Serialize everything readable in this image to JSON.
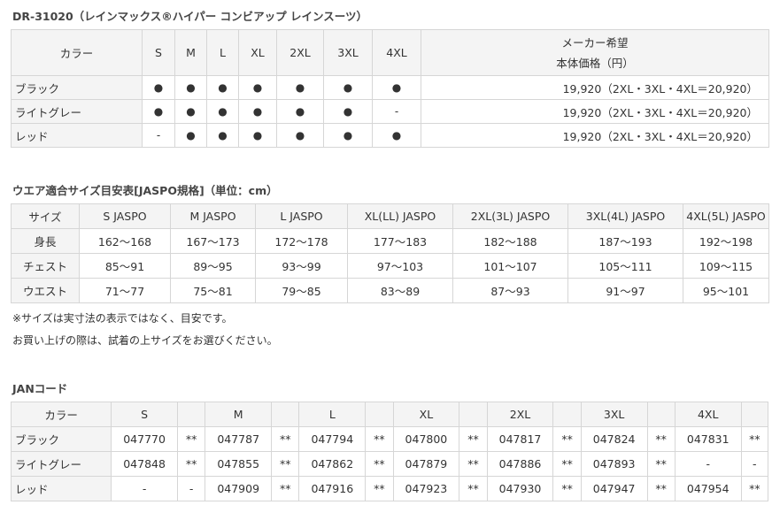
{
  "product": {
    "title": "DR-31020（レインマックス®ハイパー コンビアップ レインスーツ）",
    "price_table": {
      "color_header": "カラー",
      "sizes": [
        "S",
        "M",
        "L",
        "XL",
        "2XL",
        "3XL",
        "4XL"
      ],
      "price_header_line1": "メーカー希望",
      "price_header_line2": "本体価格（円）",
      "rows": [
        {
          "color": "ブラック",
          "avail": [
            "●",
            "●",
            "●",
            "●",
            "●",
            "●",
            "●"
          ],
          "price": "19,920（2XL・3XL・4XL＝20,920）"
        },
        {
          "color": "ライトグレー",
          "avail": [
            "●",
            "●",
            "●",
            "●",
            "●",
            "●",
            "-"
          ],
          "price": "19,920（2XL・3XL・4XL＝20,920）"
        },
        {
          "color": "レッド",
          "avail": [
            "-",
            "●",
            "●",
            "●",
            "●",
            "●",
            "●"
          ],
          "price": "19,920（2XL・3XL・4XL＝20,920）"
        }
      ]
    }
  },
  "size_guide": {
    "title": "ウエア適合サイズ目安表[JASPO規格]（単位：cm）",
    "header_label": "サイズ",
    "columns": [
      "S JASPO",
      "M JASPO",
      "L JASPO",
      "XL(LL) JASPO",
      "2XL(3L) JASPO",
      "3XL(4L) JASPO",
      "4XL(5L) JASPO"
    ],
    "rows": [
      {
        "label": "身長",
        "values": [
          "162～168",
          "167～173",
          "172～178",
          "177～183",
          "182～188",
          "187～193",
          "192～198"
        ]
      },
      {
        "label": "チェスト",
        "values": [
          "85～91",
          "89～95",
          "93～99",
          "97～103",
          "101～107",
          "105～111",
          "109～115"
        ]
      },
      {
        "label": "ウエスト",
        "values": [
          "71～77",
          "75～81",
          "79～85",
          "83～89",
          "87～93",
          "91～97",
          "95～101"
        ]
      }
    ],
    "note1": "※サイズは実寸法の表示ではなく、目安です。",
    "note2": "お買い上げの際は、試着の上サイズをお選びください。"
  },
  "jan": {
    "title": "JANコード",
    "color_header": "カラー",
    "sizes": [
      "S",
      "M",
      "L",
      "XL",
      "2XL",
      "3XL",
      "4XL"
    ],
    "rows": [
      {
        "color": "ブラック",
        "cells": [
          "047770",
          "**",
          "047787",
          "**",
          "047794",
          "**",
          "047800",
          "**",
          "047817",
          "**",
          "047824",
          "**",
          "047831",
          "**"
        ]
      },
      {
        "color": "ライトグレー",
        "cells": [
          "047848",
          "**",
          "047855",
          "**",
          "047862",
          "**",
          "047879",
          "**",
          "047886",
          "**",
          "047893",
          "**",
          "-",
          "-"
        ]
      },
      {
        "color": "レッド",
        "cells": [
          "-",
          "-",
          "047909",
          "**",
          "047916",
          "**",
          "047923",
          "**",
          "047930",
          "**",
          "047947",
          "**",
          "047954",
          "**"
        ]
      }
    ]
  }
}
